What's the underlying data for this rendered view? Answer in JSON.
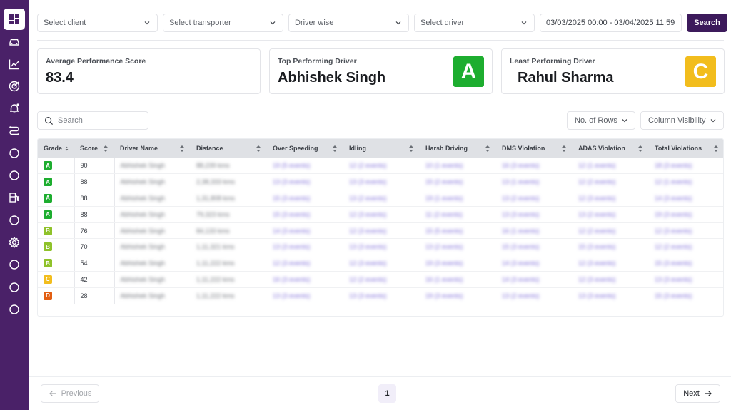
{
  "colors": {
    "sidebar": "#4a2168",
    "primary": "#3c1a5b",
    "grade_A": "#1dad2f",
    "grade_B": "#8fc22a",
    "grade_C": "#f2bd1d",
    "grade_D": "#e25e12"
  },
  "sidebar": {
    "items": [
      {
        "icon": "dashboard-icon",
        "active": true
      },
      {
        "icon": "car-icon"
      },
      {
        "icon": "line-chart-icon"
      },
      {
        "icon": "target-icon"
      },
      {
        "icon": "bell-icon"
      },
      {
        "icon": "route-icon"
      },
      {
        "icon": "circle-icon"
      },
      {
        "icon": "circle-icon"
      },
      {
        "icon": "fuel-icon"
      },
      {
        "icon": "circle-icon"
      },
      {
        "icon": "gear-icon"
      },
      {
        "icon": "circle-icon"
      },
      {
        "icon": "circle-icon"
      },
      {
        "icon": "circle-icon"
      }
    ]
  },
  "filters": {
    "client": "Select client",
    "transporter": "Select transporter",
    "mode": "Driver wise",
    "driver": "Select driver",
    "date_range": "03/03/2025 00:00 - 03/04/2025 11:59",
    "search_label": "Search"
  },
  "cards": {
    "average": {
      "label": "Average Performance Score",
      "value": "83.4"
    },
    "top": {
      "label": "Top Performing Driver",
      "value": "Abhishek Singh",
      "grade": "A"
    },
    "least": {
      "label": "Least Performing Driver",
      "value": "Rahul Sharma",
      "grade": "C"
    }
  },
  "toolbar": {
    "search_placeholder": "Search",
    "rows_label": "No. of Rows",
    "columns_label": "Column Visibility"
  },
  "table": {
    "columns": [
      "Grade",
      "Score",
      "Driver Name",
      "Distance",
      "Over Speeding",
      "Idling",
      "Harsh Driving",
      "DMS Violation",
      "ADAS Violation",
      "Total Violations"
    ],
    "rows": [
      {
        "grade": "A",
        "score": "90",
        "name": "Abhishek Singh",
        "distance": "88,239 kms",
        "over": "19 (5 events)",
        "idling": "12 (2 events)",
        "harsh": "10 (1 events)",
        "dms": "16 (3 events)",
        "adas": "12 (1 events)",
        "total": "18 (3 events)"
      },
      {
        "grade": "A",
        "score": "88",
        "name": "Abhishek Singh",
        "distance": "2,38,333 kms",
        "over": "13 (3 events)",
        "idling": "13 (3 events)",
        "harsh": "15 (2 events)",
        "dms": "13 (1 events)",
        "adas": "12 (2 events)",
        "total": "12 (1 events)"
      },
      {
        "grade": "A",
        "score": "88",
        "name": "Abhishek Singh",
        "distance": "1,31,808 kms",
        "over": "15 (3 events)",
        "idling": "13 (2 events)",
        "harsh": "19 (1 events)",
        "dms": "13 (2 events)",
        "adas": "12 (3 events)",
        "total": "14 (3 events)"
      },
      {
        "grade": "A",
        "score": "88",
        "name": "Abhishek Singh",
        "distance": "79,323 kms",
        "over": "15 (3 events)",
        "idling": "12 (3 events)",
        "harsh": "11 (2 events)",
        "dms": "13 (3 events)",
        "adas": "13 (2 events)",
        "total": "19 (3 events)"
      },
      {
        "grade": "B",
        "score": "76",
        "name": "Abhishek Singh",
        "distance": "84,133 kms",
        "over": "14 (3 events)",
        "idling": "12 (3 events)",
        "harsh": "15 (5 events)",
        "dms": "16 (1 events)",
        "adas": "12 (2 events)",
        "total": "12 (3 events)"
      },
      {
        "grade": "B",
        "score": "70",
        "name": "Abhishek Singh",
        "distance": "1,11,321 kms",
        "over": "13 (3 events)",
        "idling": "13 (3 events)",
        "harsh": "13 (2 events)",
        "dms": "15 (3 events)",
        "adas": "15 (3 events)",
        "total": "12 (2 events)"
      },
      {
        "grade": "B",
        "score": "54",
        "name": "Abhishek Singh",
        "distance": "1,11,222 kms",
        "over": "12 (3 events)",
        "idling": "12 (3 events)",
        "harsh": "19 (3 events)",
        "dms": "14 (3 events)",
        "adas": "12 (3 events)",
        "total": "15 (3 events)"
      },
      {
        "grade": "C",
        "score": "42",
        "name": "Abhishek Singh",
        "distance": "1,11,222 kms",
        "over": "16 (3 events)",
        "idling": "12 (2 events)",
        "harsh": "16 (1 events)",
        "dms": "14 (3 events)",
        "adas": "12 (3 events)",
        "total": "13 (3 events)"
      },
      {
        "grade": "D",
        "score": "28",
        "name": "Abhishek Singh",
        "distance": "1,11,222 kms",
        "over": "13 (3 events)",
        "idling": "13 (3 events)",
        "harsh": "19 (3 events)",
        "dms": "13 (2 events)",
        "adas": "13 (3 events)",
        "total": "15 (3 events)"
      }
    ]
  },
  "pagination": {
    "previous": "Previous",
    "page": "1",
    "next": "Next"
  }
}
